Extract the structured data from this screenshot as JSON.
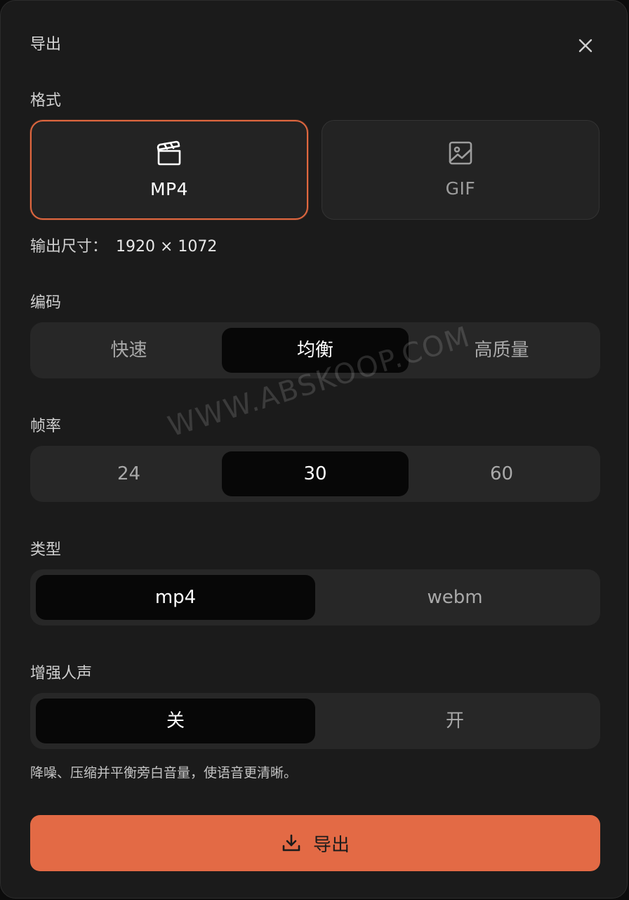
{
  "dialog": {
    "title": "导出",
    "close_icon": "close-icon"
  },
  "format": {
    "label": "格式",
    "options": [
      {
        "label": "MP4",
        "icon": "video-clapper-icon",
        "selected": true
      },
      {
        "label": "GIF",
        "icon": "image-icon",
        "selected": false
      }
    ],
    "output_size_label": "输出尺寸：",
    "output_size_value": "1920 × 1072"
  },
  "encoding": {
    "label": "编码",
    "options": [
      "快速",
      "均衡",
      "高质量"
    ],
    "selected": "均衡"
  },
  "framerate": {
    "label": "帧率",
    "options": [
      "24",
      "30",
      "60"
    ],
    "selected": "30"
  },
  "type": {
    "label": "类型",
    "options": [
      "mp4",
      "webm"
    ],
    "selected": "mp4"
  },
  "voice": {
    "label": "增强人声",
    "options": [
      "关",
      "开"
    ],
    "selected": "关",
    "hint": "降噪、压缩并平衡旁白音量，使语音更清晰。"
  },
  "export_button": {
    "label": "导出",
    "icon": "download-icon"
  },
  "watermark": "WWW.ABSKOOP.COM",
  "colors": {
    "accent": "#e36a45",
    "background": "#1b1b1b",
    "segment": "#272727",
    "segment_active": "#070707"
  }
}
